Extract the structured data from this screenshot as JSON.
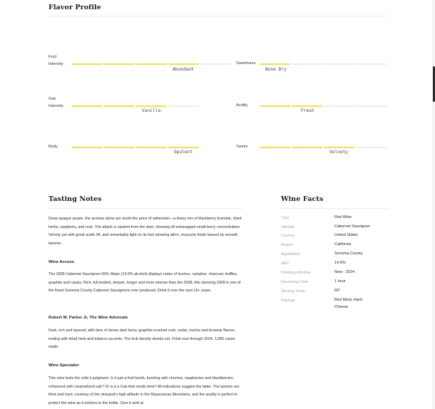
{
  "flavor_profile": {
    "title": "Flavor Profile",
    "attributes": [
      {
        "label": "Fruit Intensity",
        "level": 4,
        "max": 5,
        "value": "Abundant"
      },
      {
        "label": "Sweetness",
        "level": 1,
        "max": 4,
        "value": "Bone Dry"
      },
      {
        "label": "Oak Intensity",
        "level": 3,
        "max": 4,
        "value": "Vanilla"
      },
      {
        "label": "Acidity",
        "level": 2,
        "max": 4,
        "value": "Fresh"
      },
      {
        "label": "Body",
        "level": 4,
        "max": 4,
        "value": "Opulent"
      },
      {
        "label": "Tannin",
        "level": 3,
        "max": 4,
        "value": "Velvety"
      }
    ]
  },
  "tasting_notes": {
    "title": "Tasting Notes",
    "intro": "Deep opaque purple, the aromas alone are worth the price of admission—a briary mix of blackberry bramble, dried herbs, raspberry, and rock. The attack is opulent from the start, showing off extravagant small-berry concentration. Velvety yet with great acidic lift, and remarkably light on its feet showing afirm, muscular finish braced by smooth tannins.",
    "reviews": [
      {
        "source": "Wine Access",
        "text": "The 2009 Cabernet Sauvignon 55% Slope (14.9% alcohol) displays notes of licorice, camphor, charcoal, truffles, graphite and cassis. Rich, full-bodied, deeper, longer and more intense than the 2008, this stunning 2009 is one of the finest Sonoma County Cabernet Sauvignons ever produced. Drink it over the next 15+ years."
      },
      {
        "source": "Robert M. Parker Jr, The Wine Advocate",
        "text": "Dark, rich and layered, with tiers of dense dark berry, graphite-crushed rock, cedar, mocha and brownie flavors, ending with dried herb and tobacco accents. The fruit density stands out. Drink now through 2024. 3,385 cases made."
      },
      {
        "source": "Wine Spectator",
        "text": "This wine tests the critic's judgment. Is it just a fruit bomb, bursting with cherries, raspberries and blackberries, enhanced with caramelized oak? Or is it a Cab that needs time? All indications suggest the latter. The tannins are thick and hard, courtesy of the vineyard's high altitude in the Mayacamas Mountains, and the acidity is perfect to protect the wine as it evolves in the bottle. Give it until at"
      }
    ]
  },
  "wine_facts": {
    "title": "Wine Facts",
    "rows": [
      {
        "label": "Type",
        "value": "Red Wine"
      },
      {
        "label": "Varietal",
        "value": "Cabernet Sauvignon"
      },
      {
        "label": "Country",
        "value": "United States"
      },
      {
        "label": "Region",
        "value": "California"
      },
      {
        "label": "Appellation",
        "value": "Sonoma County"
      },
      {
        "label": "ABV",
        "value": "14.9%"
      },
      {
        "label": "Drinking Window",
        "value": "Now - 2024"
      },
      {
        "label": "Decanting Time",
        "value": "1 hour"
      },
      {
        "label": "Serving Temp",
        "value": "60°"
      },
      {
        "label": "Pairings",
        "value": "Red Meat, Hard Cheese"
      }
    ]
  }
}
